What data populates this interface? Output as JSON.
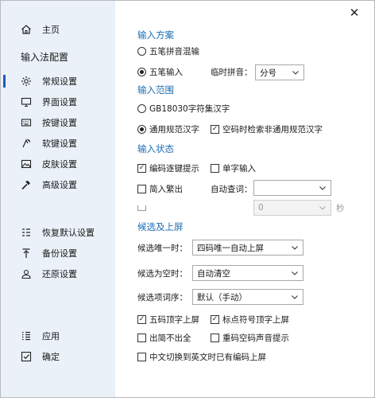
{
  "sidebar": {
    "home": "主页",
    "heading": "输入法配置",
    "items": [
      {
        "label": "常规设置",
        "icon": "gear-icon"
      },
      {
        "label": "界面设置",
        "icon": "monitor-icon"
      },
      {
        "label": "按键设置",
        "icon": "keyboard-icon"
      },
      {
        "label": "软键设置",
        "icon": "soft-key-icon"
      },
      {
        "label": "皮肤设置",
        "icon": "picture-icon"
      },
      {
        "label": "高级设置",
        "icon": "hammer-icon"
      }
    ],
    "actions": [
      {
        "label": "恢复默认设置",
        "icon": "restore-icon"
      },
      {
        "label": "备份设置",
        "icon": "upload-icon"
      },
      {
        "label": "还原设置",
        "icon": "user-restore-icon"
      }
    ],
    "bottom": [
      {
        "label": "应用",
        "icon": "list-icon"
      },
      {
        "label": "确定",
        "icon": "check-box-icon"
      }
    ],
    "accent": "#1a5fb4"
  },
  "window": {
    "close_glyph": "✕"
  },
  "scheme": {
    "title": "输入方案",
    "mixed": "五笔拼音混输",
    "wubi": "五笔输入",
    "temp_pinyin_label": "临时拼音：",
    "temp_pinyin_value": "分号"
  },
  "range": {
    "title": "输入范围",
    "gb18030": "GB18030字符集汉字",
    "common": "通用规范汉字",
    "empty_code_search": "空码时检索非通用规范汉字"
  },
  "status": {
    "title": "输入状态",
    "code_hint": "编码逐键提示",
    "single_char": "单字输入",
    "trad": "简入繁出",
    "auto_query_label": "自动查词：",
    "auto_query_value": "",
    "delay_value": "0",
    "delay_unit": "秒",
    "accent": "#1a6db3"
  },
  "candidates": {
    "title": "候选及上屏",
    "unique_label": "候选唯一时：",
    "unique_value": "四码唯一自动上屏",
    "empty_label": "候选为空时：",
    "empty_value": "自动清空",
    "order_label": "候选项词序：",
    "order_value": "默认（手动）",
    "fifth_code": "五码顶字上屏",
    "punct": "标点符号顶字上屏",
    "no_simple": "出简不出全",
    "dup_sound": "重码空码声音提示",
    "switch_commit": "中文切换到英文时已有编码上屏"
  }
}
